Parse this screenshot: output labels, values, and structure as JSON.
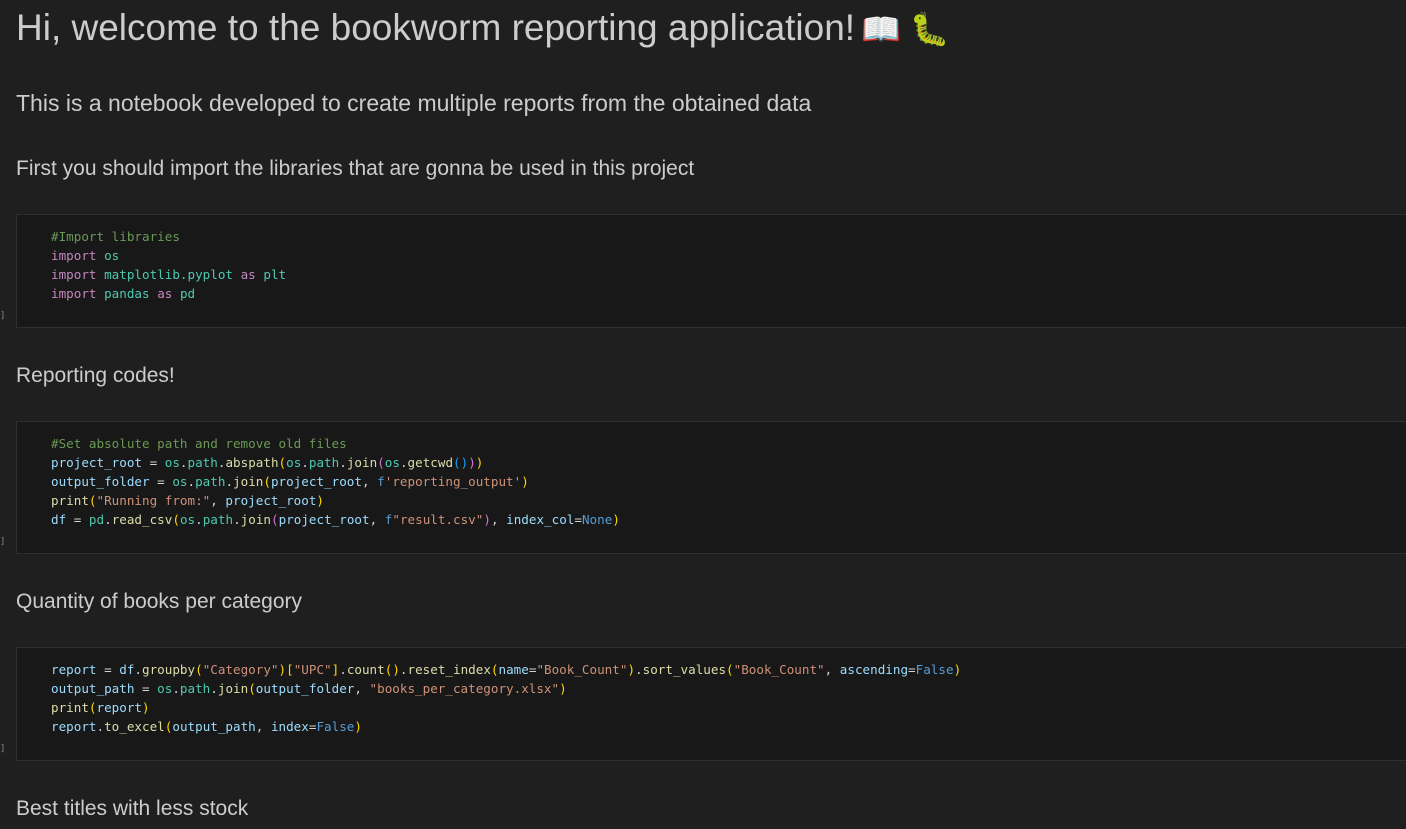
{
  "markdown": {
    "title": "Hi, welcome to the bookworm reporting application!",
    "title_emoji": "📖 🐛",
    "intro": "This is a notebook developed to create multiple reports from the obtained data",
    "import_note": "First you should import the libraries that are gonna be used in this project",
    "reporting_heading": "Reporting codes!",
    "quantity_heading": "Quantity of books per category",
    "best_titles_heading": "Best titles with less stock"
  },
  "cells": [
    {
      "bracket": "]",
      "lines": [
        [
          {
            "t": "#Import libraries",
            "c": "comment"
          }
        ],
        [
          {
            "t": "import",
            "c": "kw"
          },
          {
            "t": " ",
            "c": "op"
          },
          {
            "t": "os",
            "c": "mod"
          }
        ],
        [
          {
            "t": "import",
            "c": "kw"
          },
          {
            "t": " ",
            "c": "op"
          },
          {
            "t": "matplotlib.pyplot",
            "c": "mod"
          },
          {
            "t": " ",
            "c": "op"
          },
          {
            "t": "as",
            "c": "kw"
          },
          {
            "t": " ",
            "c": "op"
          },
          {
            "t": "plt",
            "c": "mod"
          }
        ],
        [
          {
            "t": "import",
            "c": "kw"
          },
          {
            "t": " ",
            "c": "op"
          },
          {
            "t": "pandas",
            "c": "mod"
          },
          {
            "t": " ",
            "c": "op"
          },
          {
            "t": "as",
            "c": "kw"
          },
          {
            "t": " ",
            "c": "op"
          },
          {
            "t": "pd",
            "c": "mod"
          }
        ]
      ]
    },
    {
      "bracket": "]",
      "lines": [
        [
          {
            "t": "#Set absolute path and remove old files",
            "c": "comment"
          }
        ],
        [
          {
            "t": "project_root",
            "c": "var"
          },
          {
            "t": " = ",
            "c": "op"
          },
          {
            "t": "os",
            "c": "mod"
          },
          {
            "t": ".",
            "c": "op"
          },
          {
            "t": "path",
            "c": "mod"
          },
          {
            "t": ".",
            "c": "op"
          },
          {
            "t": "abspath",
            "c": "fn"
          },
          {
            "t": "(",
            "c": "p1"
          },
          {
            "t": "os",
            "c": "mod"
          },
          {
            "t": ".",
            "c": "op"
          },
          {
            "t": "path",
            "c": "mod"
          },
          {
            "t": ".",
            "c": "op"
          },
          {
            "t": "join",
            "c": "fn"
          },
          {
            "t": "(",
            "c": "p2"
          },
          {
            "t": "os",
            "c": "mod"
          },
          {
            "t": ".",
            "c": "op"
          },
          {
            "t": "getcwd",
            "c": "fn"
          },
          {
            "t": "()",
            "c": "p3"
          },
          {
            "t": ")",
            "c": "p2"
          },
          {
            "t": ")",
            "c": "p1"
          }
        ],
        [
          {
            "t": "output_folder",
            "c": "var"
          },
          {
            "t": " = ",
            "c": "op"
          },
          {
            "t": "os",
            "c": "mod"
          },
          {
            "t": ".",
            "c": "op"
          },
          {
            "t": "path",
            "c": "mod"
          },
          {
            "t": ".",
            "c": "op"
          },
          {
            "t": "join",
            "c": "fn"
          },
          {
            "t": "(",
            "c": "p1"
          },
          {
            "t": "project_root",
            "c": "var"
          },
          {
            "t": ", ",
            "c": "op"
          },
          {
            "t": "f",
            "c": "const"
          },
          {
            "t": "'reporting_output'",
            "c": "str"
          },
          {
            "t": ")",
            "c": "p1"
          }
        ],
        [
          {
            "t": "print",
            "c": "fn"
          },
          {
            "t": "(",
            "c": "p1"
          },
          {
            "t": "\"Running from:\"",
            "c": "str"
          },
          {
            "t": ", ",
            "c": "op"
          },
          {
            "t": "project_root",
            "c": "var"
          },
          {
            "t": ")",
            "c": "p1"
          }
        ],
        [
          {
            "t": "df",
            "c": "var"
          },
          {
            "t": " = ",
            "c": "op"
          },
          {
            "t": "pd",
            "c": "mod"
          },
          {
            "t": ".",
            "c": "op"
          },
          {
            "t": "read_csv",
            "c": "fn"
          },
          {
            "t": "(",
            "c": "p1"
          },
          {
            "t": "os",
            "c": "mod"
          },
          {
            "t": ".",
            "c": "op"
          },
          {
            "t": "path",
            "c": "mod"
          },
          {
            "t": ".",
            "c": "op"
          },
          {
            "t": "join",
            "c": "fn"
          },
          {
            "t": "(",
            "c": "p2"
          },
          {
            "t": "project_root",
            "c": "var"
          },
          {
            "t": ", ",
            "c": "op"
          },
          {
            "t": "f",
            "c": "const"
          },
          {
            "t": "\"result.csv\"",
            "c": "str"
          },
          {
            "t": ")",
            "c": "p2"
          },
          {
            "t": ", ",
            "c": "op"
          },
          {
            "t": "index_col",
            "c": "var"
          },
          {
            "t": "=",
            "c": "op"
          },
          {
            "t": "None",
            "c": "const"
          },
          {
            "t": ")",
            "c": "p1"
          }
        ]
      ]
    },
    {
      "bracket": "]",
      "lines": [
        [
          {
            "t": "report",
            "c": "var"
          },
          {
            "t": " = ",
            "c": "op"
          },
          {
            "t": "df",
            "c": "var"
          },
          {
            "t": ".",
            "c": "op"
          },
          {
            "t": "groupby",
            "c": "fn"
          },
          {
            "t": "(",
            "c": "p1"
          },
          {
            "t": "\"Category\"",
            "c": "str"
          },
          {
            "t": ")",
            "c": "p1"
          },
          {
            "t": "[",
            "c": "p1"
          },
          {
            "t": "\"UPC\"",
            "c": "str"
          },
          {
            "t": "]",
            "c": "p1"
          },
          {
            "t": ".",
            "c": "op"
          },
          {
            "t": "count",
            "c": "fn"
          },
          {
            "t": "()",
            "c": "p1"
          },
          {
            "t": ".",
            "c": "op"
          },
          {
            "t": "reset_index",
            "c": "fn"
          },
          {
            "t": "(",
            "c": "p1"
          },
          {
            "t": "name",
            "c": "var"
          },
          {
            "t": "=",
            "c": "op"
          },
          {
            "t": "\"Book_Count\"",
            "c": "str"
          },
          {
            "t": ")",
            "c": "p1"
          },
          {
            "t": ".",
            "c": "op"
          },
          {
            "t": "sort_values",
            "c": "fn"
          },
          {
            "t": "(",
            "c": "p1"
          },
          {
            "t": "\"Book_Count\"",
            "c": "str"
          },
          {
            "t": ", ",
            "c": "op"
          },
          {
            "t": "ascending",
            "c": "var"
          },
          {
            "t": "=",
            "c": "op"
          },
          {
            "t": "False",
            "c": "const"
          },
          {
            "t": ")",
            "c": "p1"
          }
        ],
        [
          {
            "t": "output_path",
            "c": "var"
          },
          {
            "t": " = ",
            "c": "op"
          },
          {
            "t": "os",
            "c": "mod"
          },
          {
            "t": ".",
            "c": "op"
          },
          {
            "t": "path",
            "c": "mod"
          },
          {
            "t": ".",
            "c": "op"
          },
          {
            "t": "join",
            "c": "fn"
          },
          {
            "t": "(",
            "c": "p1"
          },
          {
            "t": "output_folder",
            "c": "var"
          },
          {
            "t": ", ",
            "c": "op"
          },
          {
            "t": "\"books_per_category.xlsx\"",
            "c": "str"
          },
          {
            "t": ")",
            "c": "p1"
          }
        ],
        [
          {
            "t": "print",
            "c": "fn"
          },
          {
            "t": "(",
            "c": "p1"
          },
          {
            "t": "report",
            "c": "var"
          },
          {
            "t": ")",
            "c": "p1"
          }
        ],
        [
          {
            "t": "report",
            "c": "var"
          },
          {
            "t": ".",
            "c": "op"
          },
          {
            "t": "to_excel",
            "c": "fn"
          },
          {
            "t": "(",
            "c": "p1"
          },
          {
            "t": "output_path",
            "c": "var"
          },
          {
            "t": ", ",
            "c": "op"
          },
          {
            "t": "index",
            "c": "var"
          },
          {
            "t": "=",
            "c": "op"
          },
          {
            "t": "False",
            "c": "const"
          },
          {
            "t": ")",
            "c": "p1"
          }
        ]
      ]
    }
  ]
}
